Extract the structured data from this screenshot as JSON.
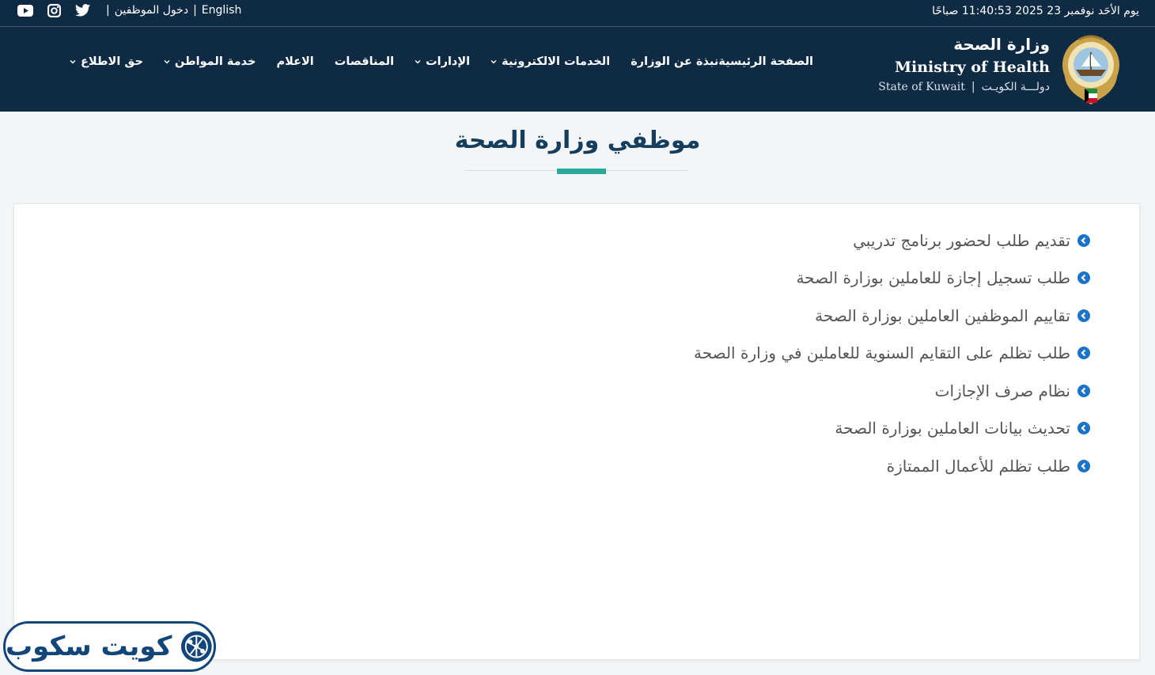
{
  "topbar": {
    "date": "يوم الأحَد نوفمبر 23 2025 11:40:53 صباحًا",
    "language_link": "English",
    "employee_login": "دخول الموظفين",
    "separator": "|"
  },
  "brand": {
    "name_ar": "وزارة الصحة",
    "name_en": "Ministry of Health",
    "state_en": "State of Kuwait",
    "state_sep": "|",
    "state_ar": "دولـــة الكويـت"
  },
  "nav": [
    {
      "label": "الصفحة الرئيسية",
      "dropdown": false
    },
    {
      "label": "نبذة عن الوزارة",
      "dropdown": false
    },
    {
      "label": "الخدمات الالكترونية",
      "dropdown": true
    },
    {
      "label": "الإدارات",
      "dropdown": true
    },
    {
      "label": "المناقصات",
      "dropdown": false
    },
    {
      "label": "الاعلام",
      "dropdown": false
    },
    {
      "label": "خدمة المواطن",
      "dropdown": true
    },
    {
      "label": "حق الاطلاع",
      "dropdown": true
    }
  ],
  "page": {
    "title": "موظفي وزارة الصحة"
  },
  "links": [
    "تقديم طلب لحضور برنامج تدريبي",
    "طلب تسجيل إجازة للعاملين بوزارة الصحة",
    "تقاييم الموظفين العاملين بوزارة الصحة",
    "طلب تظلم على التقايم السنوية للعاملين في وزارة الصحة",
    "نظام صرف الإجازات",
    "تحديث بيانات العاملين بوزارة الصحة",
    "طلب تظلم للأعمال الممتازة"
  ],
  "watermark": {
    "text": "كويت سكوب"
  },
  "colors": {
    "header_bg": "#0f2b44",
    "title": "#143d5e",
    "accent": "#2ba89a",
    "bullet": "#1a73c8",
    "link_text": "#555555",
    "watermark": "#12467a"
  },
  "icons": {
    "social": [
      "youtube-icon",
      "instagram-icon",
      "twitter-icon"
    ],
    "bullet": "circle-arrow-left-icon",
    "dropdown": "chevron-down-icon"
  }
}
